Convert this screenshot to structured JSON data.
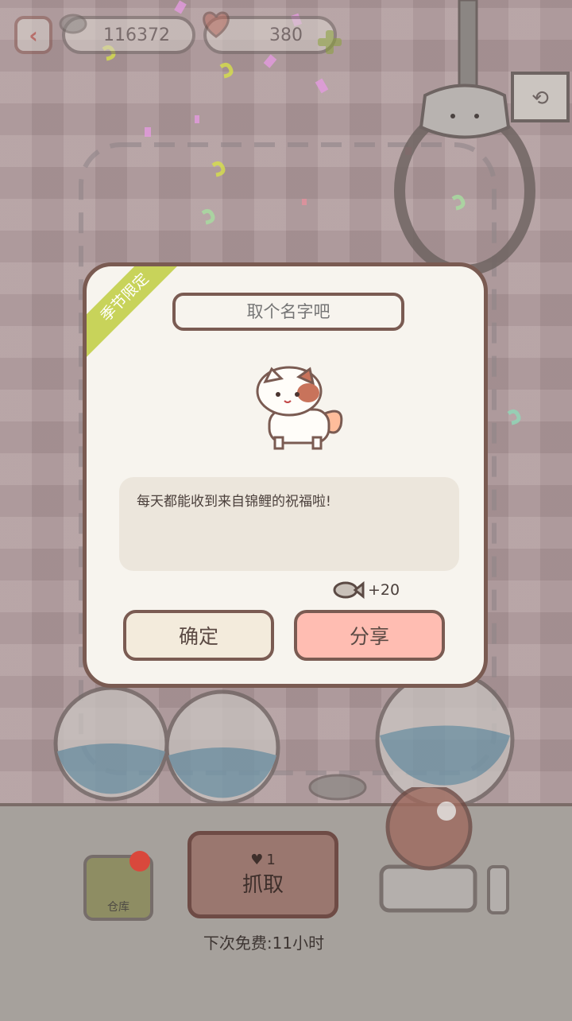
{
  "header": {
    "back_icon": "chevron-left-icon",
    "fish_count": "116372",
    "heart_count": "380",
    "add_icon": "plus-icon",
    "switch_icon": "refresh-icon"
  },
  "dialog": {
    "badge": "季节限定",
    "name_placeholder": "取个名字吧",
    "description": "每天都能收到来自锦鲤的祝福啦!",
    "reward": "+20",
    "confirm_label": "确定",
    "share_label": "分享"
  },
  "controls": {
    "storage_label": "仓库",
    "grab_cost": "1",
    "grab_label": "抓取",
    "free_timer": "下次免费:11小时"
  },
  "colors": {
    "accent_green": "#c8d35a",
    "share_pink": "#ffbdb2",
    "border_brown": "#7a5b52",
    "notification_red": "#d9483c"
  }
}
